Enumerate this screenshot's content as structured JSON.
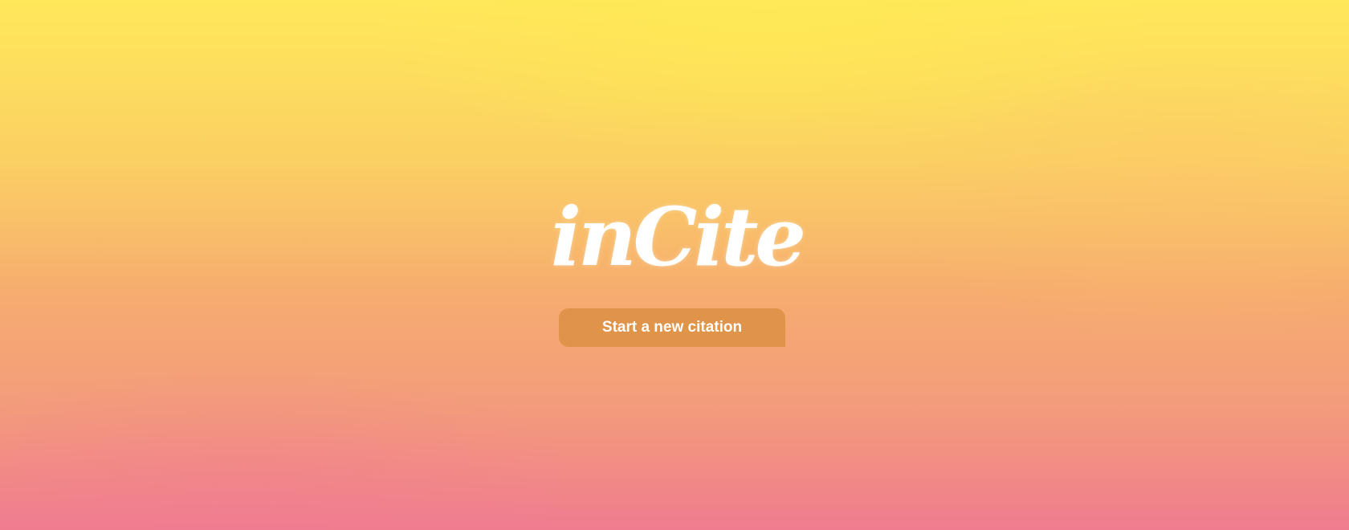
{
  "app": {
    "logo_text": "inCite",
    "start_button_label": "Start a new citation"
  },
  "colors": {
    "gradient_top": "#ffe85a",
    "gradient_bottom": "#f07c90",
    "button_background": "#e0944a",
    "text": "#ffffff"
  }
}
